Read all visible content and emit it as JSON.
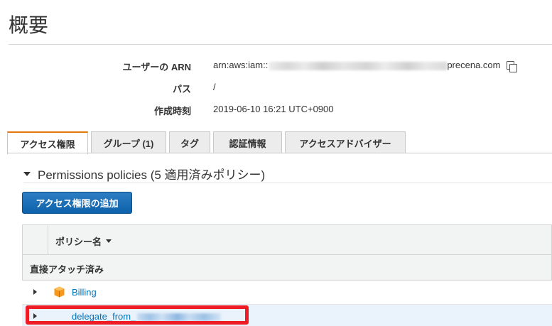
{
  "page": {
    "title": "概要"
  },
  "summary": {
    "arn_label": "ユーザーの ARN",
    "arn_prefix": "arn:aws:iam::",
    "arn_suffix": "precena.com",
    "path_label": "パス",
    "path_value": "/",
    "created_label": "作成時刻",
    "created_value": "2019-06-10 16:21 UTC+0900"
  },
  "tabs": [
    {
      "label": "アクセス権限",
      "active": true
    },
    {
      "label": "グループ (1)",
      "active": false
    },
    {
      "label": "タグ",
      "active": false
    },
    {
      "label": "認証情報",
      "active": false
    },
    {
      "label": "アクセスアドバイザー",
      "active": false
    }
  ],
  "permissions": {
    "section_title": "Permissions policies (5 適用済みポリシー)",
    "add_button": "アクセス権限の追加",
    "column_header": "ポリシー名",
    "group_label": "直接アタッチ済み",
    "rows": [
      {
        "name": "Billing",
        "icon": "aws-managed-policy-icon"
      },
      {
        "name": "delegate_from_",
        "icon": "none"
      }
    ]
  },
  "colors": {
    "accent_tab": "#e47911",
    "button": "#0d62ab",
    "link": "#0073bb",
    "highlight": "#ee1c25"
  }
}
